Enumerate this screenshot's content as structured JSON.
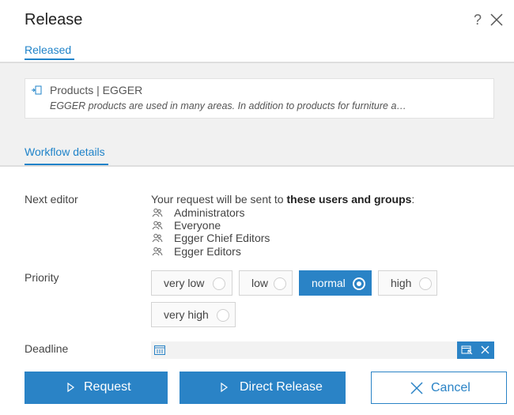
{
  "dialog": {
    "title": "Release",
    "help_label": "?",
    "close_icon": "close-icon"
  },
  "tabs": {
    "released": "Released",
    "workflow_details": "Workflow details"
  },
  "released_item": {
    "icon": "document-link-icon",
    "title": "Products | EGGER",
    "description": "EGGER products are used in many areas. In addition to products for furniture a…"
  },
  "next_editor": {
    "label": "Next editor",
    "request_prefix": "Your request will be sent to ",
    "request_bold": "these users and groups",
    "request_suffix": ":",
    "groups": [
      {
        "name": "Administrators",
        "icon": "user-group-icon"
      },
      {
        "name": "Everyone",
        "icon": "user-group-icon"
      },
      {
        "name": "Egger Chief Editors",
        "icon": "user-group-icon"
      },
      {
        "name": "Egger Editors",
        "icon": "user-group-icon"
      }
    ]
  },
  "priority": {
    "label": "Priority",
    "options": [
      {
        "label": "very low",
        "selected": false
      },
      {
        "label": "low",
        "selected": false
      },
      {
        "label": "normal",
        "selected": true
      },
      {
        "label": "high",
        "selected": false
      },
      {
        "label": "very high",
        "selected": false
      }
    ]
  },
  "deadline": {
    "label": "Deadline",
    "value": "",
    "calendar_icon": "calendar-icon",
    "picker_icon": "calendar-picker-icon",
    "clear_icon": "clear-icon"
  },
  "actions": {
    "request": "Request",
    "direct_release": "Direct Release",
    "cancel": "Cancel"
  },
  "colors": {
    "accent": "#2a83c6",
    "tab_text": "#1f83c9"
  }
}
